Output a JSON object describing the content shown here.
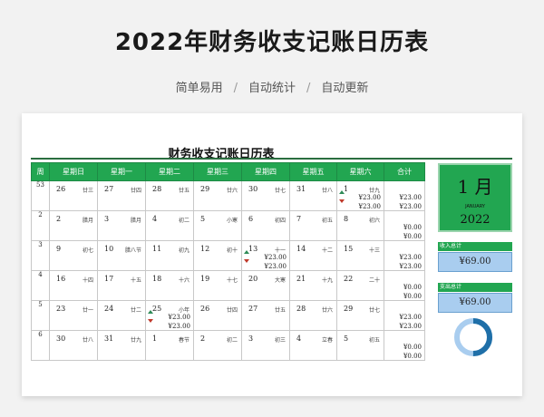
{
  "header": {
    "title": "2022年财务收支记账日历表",
    "features": [
      "简单易用",
      "自动统计",
      "自动更新"
    ]
  },
  "calendar": {
    "title": "财务收支记账日历表",
    "columns": [
      "周",
      "星期日",
      "星期一",
      "星期二",
      "星期三",
      "星期四",
      "星期五",
      "星期六",
      "合计"
    ],
    "rows": [
      {
        "week": "53",
        "days": [
          {
            "d": "26",
            "l": "廿三"
          },
          {
            "d": "27",
            "l": "廿四"
          },
          {
            "d": "28",
            "l": "廿五"
          },
          {
            "d": "29",
            "l": "廿六"
          },
          {
            "d": "30",
            "l": "廿七"
          },
          {
            "d": "31",
            "l": "廿八"
          },
          {
            "d": "1",
            "l": "廿九",
            "m1": "¥23.00",
            "m2": "¥23.00"
          }
        ],
        "total": [
          "¥23.00",
          "¥23.00"
        ]
      },
      {
        "week": "2",
        "days": [
          {
            "d": "2",
            "l": "腊月"
          },
          {
            "d": "3",
            "l": "腊月"
          },
          {
            "d": "4",
            "l": "初二"
          },
          {
            "d": "5",
            "l": "小寒"
          },
          {
            "d": "6",
            "l": "初四"
          },
          {
            "d": "7",
            "l": "初五"
          },
          {
            "d": "8",
            "l": "初六"
          }
        ],
        "total": [
          "¥0.00",
          "¥0.00"
        ]
      },
      {
        "week": "3",
        "days": [
          {
            "d": "9",
            "l": "初七"
          },
          {
            "d": "10",
            "l": "腊八节"
          },
          {
            "d": "11",
            "l": "初九"
          },
          {
            "d": "12",
            "l": "初十"
          },
          {
            "d": "13",
            "l": "十一",
            "m1": "¥23.00",
            "m2": "¥23.00"
          },
          {
            "d": "14",
            "l": "十二"
          },
          {
            "d": "15",
            "l": "十三"
          }
        ],
        "total": [
          "¥23.00",
          "¥23.00"
        ]
      },
      {
        "week": "4",
        "days": [
          {
            "d": "16",
            "l": "十四"
          },
          {
            "d": "17",
            "l": "十五"
          },
          {
            "d": "18",
            "l": "十六"
          },
          {
            "d": "19",
            "l": "十七"
          },
          {
            "d": "20",
            "l": "大寒"
          },
          {
            "d": "21",
            "l": "十九"
          },
          {
            "d": "22",
            "l": "二十"
          }
        ],
        "total": [
          "¥0.00",
          "¥0.00"
        ]
      },
      {
        "week": "5",
        "days": [
          {
            "d": "23",
            "l": "廿一"
          },
          {
            "d": "24",
            "l": "廿二"
          },
          {
            "d": "25",
            "l": "小年",
            "m1": "¥23.00",
            "m2": "¥23.00"
          },
          {
            "d": "26",
            "l": "廿四"
          },
          {
            "d": "27",
            "l": "廿五"
          },
          {
            "d": "28",
            "l": "廿六"
          },
          {
            "d": "29",
            "l": "廿七"
          }
        ],
        "total": [
          "¥23.00",
          "¥23.00"
        ]
      },
      {
        "week": "6",
        "days": [
          {
            "d": "30",
            "l": "廿八"
          },
          {
            "d": "31",
            "l": "廿九"
          },
          {
            "d": "1",
            "l": "春节"
          },
          {
            "d": "2",
            "l": "初二"
          },
          {
            "d": "3",
            "l": "初三"
          },
          {
            "d": "4",
            "l": "立春"
          },
          {
            "d": "5",
            "l": "初五"
          }
        ],
        "total": [
          "¥0.00",
          "¥0.00"
        ]
      }
    ]
  },
  "side_panel": {
    "month": "1 月",
    "month_en": "JANUARY",
    "year": "2022",
    "income_label": "收入总计",
    "income_value": "¥69.00",
    "expense_label": "支出总计",
    "expense_value": "¥69.00"
  },
  "donut": {
    "income_share": 0.5,
    "colors": [
      "#1f6fa8",
      "#a9cdef"
    ]
  },
  "colors": {
    "header_green": "#22a651",
    "amount_blue": "#a9cdef"
  }
}
